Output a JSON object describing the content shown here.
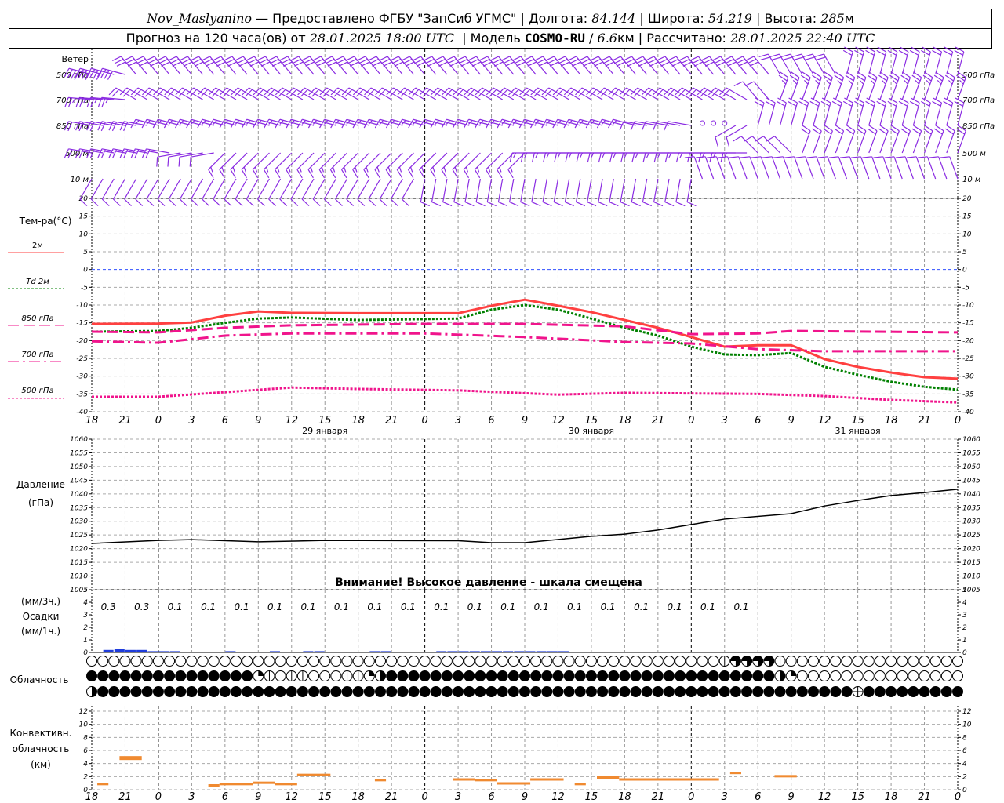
{
  "header": {
    "station": "Nov_Maslyanino",
    "provided": " — Предоставлено ФГБУ \"ЗапСиб УГМС\" | Долгота: ",
    "lon": "84.144",
    "lat_label": " | Широта: ",
    "lat": "54.219",
    "alt_label": " | Высота: ",
    "alt": "285",
    "alt_unit": "м",
    "forecast_label": "Прогноз на 120 часа(ов) от ",
    "forecast_time": "28.01.2025 18:00 UTC",
    "model_label": "  | Модель ",
    "model": "COSMO-RU",
    "model_sep": " / ",
    "res": "6.6",
    "res_unit": "км",
    "calc_label": " | Рассчитано: ",
    "calc_time": "28.01.2025 22:40 UTC"
  },
  "labels": {
    "wind": "Ветер",
    "wind_levels": [
      "500 гПа",
      "700 гПа",
      "850 гПа",
      "500 м",
      "10 м"
    ],
    "temp": "Тем-ра(°C)",
    "temp_legend": [
      "2м",
      "Td  2м",
      "850 гПа",
      "700 гПа",
      "500 гПа"
    ],
    "pressure": "Давление",
    "pressure_unit": "(гПа)",
    "precip_3h": "(мм/3ч.)",
    "precip": "Осадки",
    "precip_1h": "(мм/1ч.)",
    "cloud": "Облачность",
    "conv1": "Конвективн.",
    "conv2": "облачность",
    "conv3": "(км)",
    "warning": "Внимание! Высокое давление - шкала смещена"
  },
  "colors": {
    "t2m": "#ff4040",
    "td2m": "#008000",
    "upper": "#f0148c",
    "wind": "#8a2be2",
    "precip": "#1e3cdc",
    "conv": "#f08a30",
    "zero": "#3050ff"
  },
  "chart_data": {
    "type": "line",
    "x_unit": "hours since 28.01.2025 18:00 UTC",
    "time_labels": [
      "18",
      "21",
      "0",
      "3",
      "6",
      "9",
      "12",
      "15",
      "18",
      "21",
      "0",
      "3",
      "6",
      "9",
      "12",
      "15",
      "18",
      "21",
      "0",
      "3",
      "6",
      "9",
      "12",
      "15",
      "18",
      "21",
      "0"
    ],
    "date_labels": [
      {
        "h": 21,
        "text": "29 января"
      },
      {
        "h": 45,
        "text": "30 января"
      },
      {
        "h": 69,
        "text": "31 января"
      }
    ],
    "temperature": {
      "ylim": [
        -40,
        20
      ],
      "ticks": [
        20,
        15,
        10,
        5,
        0,
        -5,
        -10,
        -15,
        -20,
        -25,
        -30,
        -35,
        -40
      ],
      "series": [
        {
          "name": "2м",
          "style": "solid",
          "points": [
            [
              0,
              -15.3
            ],
            [
              6,
              -15.2
            ],
            [
              9,
              -14.9
            ],
            [
              12,
              -13
            ],
            [
              15,
              -11.8
            ],
            [
              18,
              -12.2
            ],
            [
              24,
              -12.3
            ],
            [
              33,
              -12.3
            ],
            [
              36,
              -10.2
            ],
            [
              39,
              -8.5
            ],
            [
              42,
              -10.2
            ],
            [
              45,
              -12
            ],
            [
              48,
              -14.2
            ],
            [
              51,
              -16.4
            ],
            [
              54,
              -19
            ],
            [
              57,
              -21.7
            ],
            [
              60,
              -21.3
            ],
            [
              63,
              -21.3
            ],
            [
              66,
              -25.2
            ],
            [
              69,
              -27.4
            ],
            [
              72,
              -29
            ],
            [
              75,
              -30.3
            ],
            [
              78,
              -30.7
            ]
          ]
        },
        {
          "name": "Td  2м",
          "style": "dotted-green",
          "points": [
            [
              0,
              -17.5
            ],
            [
              6,
              -17.3
            ],
            [
              9,
              -16.4
            ],
            [
              12,
              -15
            ],
            [
              15,
              -13.8
            ],
            [
              18,
              -13.5
            ],
            [
              24,
              -14.2
            ],
            [
              33,
              -13.8
            ],
            [
              36,
              -11.3
            ],
            [
              39,
              -10
            ],
            [
              42,
              -11.3
            ],
            [
              45,
              -13.8
            ],
            [
              48,
              -16.4
            ],
            [
              51,
              -18.6
            ],
            [
              54,
              -21.7
            ],
            [
              57,
              -23.9
            ],
            [
              60,
              -24.1
            ],
            [
              63,
              -23.5
            ],
            [
              66,
              -27.4
            ],
            [
              69,
              -29.6
            ],
            [
              72,
              -31.6
            ],
            [
              75,
              -33
            ],
            [
              78,
              -33.8
            ]
          ]
        },
        {
          "name": "850 гПа",
          "style": "dashed",
          "points": [
            [
              0,
              -17.5
            ],
            [
              6,
              -17.7
            ],
            [
              12,
              -16.4
            ],
            [
              18,
              -15.7
            ],
            [
              30,
              -15.3
            ],
            [
              39,
              -15.3
            ],
            [
              48,
              -16
            ],
            [
              54,
              -18.2
            ],
            [
              60,
              -18
            ],
            [
              63,
              -17.3
            ],
            [
              78,
              -17.7
            ]
          ]
        },
        {
          "name": "700 гПа",
          "style": "dashdot",
          "points": [
            [
              0,
              -20.2
            ],
            [
              6,
              -20.6
            ],
            [
              12,
              -18.6
            ],
            [
              18,
              -18
            ],
            [
              30,
              -18
            ],
            [
              39,
              -19
            ],
            [
              48,
              -20.4
            ],
            [
              54,
              -20.8
            ],
            [
              60,
              -22.4
            ],
            [
              66,
              -23
            ],
            [
              78,
              -23
            ]
          ]
        },
        {
          "name": "500 гПа",
          "style": "dotted",
          "points": [
            [
              0,
              -35.8
            ],
            [
              6,
              -35.8
            ],
            [
              12,
              -34.5
            ],
            [
              18,
              -33.2
            ],
            [
              24,
              -33.6
            ],
            [
              33,
              -34
            ],
            [
              42,
              -35.2
            ],
            [
              48,
              -34.7
            ],
            [
              60,
              -35
            ],
            [
              66,
              -35.6
            ],
            [
              72,
              -36.7
            ],
            [
              78,
              -37.4
            ]
          ]
        }
      ]
    },
    "pressure": {
      "ylim": [
        1005,
        1060
      ],
      "ticks": [
        1060,
        1055,
        1050,
        1045,
        1040,
        1035,
        1030,
        1025,
        1020,
        1015,
        1010,
        1005
      ],
      "points": [
        [
          0,
          1021.9
        ],
        [
          6,
          1023
        ],
        [
          9,
          1023.3
        ],
        [
          15,
          1022.5
        ],
        [
          21,
          1023
        ],
        [
          33,
          1022.9
        ],
        [
          36,
          1022.2
        ],
        [
          39,
          1022.2
        ],
        [
          45,
          1024.5
        ],
        [
          48,
          1025.3
        ],
        [
          51,
          1026.8
        ],
        [
          54,
          1028.8
        ],
        [
          57,
          1030.8
        ],
        [
          63,
          1032.8
        ],
        [
          66,
          1035.6
        ],
        [
          69,
          1037.6
        ],
        [
          72,
          1039.4
        ],
        [
          75,
          1040.5
        ],
        [
          78,
          1041.7
        ]
      ]
    },
    "precip": {
      "ylim": [
        0,
        5
      ],
      "ticks": [
        5,
        4,
        3,
        2,
        1,
        0
      ],
      "totals_3h": [
        "0.3",
        "0.3",
        "0.1",
        "0.1",
        "0.1",
        "0.1",
        "0.1",
        "0.1",
        "0.1",
        "0.1",
        "0.1",
        "0.1",
        "0.1",
        "0.1",
        "0.1",
        "0.1",
        "0.1",
        "0.1",
        "0.1",
        "0.1"
      ],
      "hourly": [
        0,
        0.2,
        0.3,
        0.2,
        0.2,
        0.1,
        0.1,
        0.1,
        0.05,
        0.05,
        0.05,
        0.05,
        0.1,
        0.05,
        0.05,
        0.05,
        0.1,
        0.05,
        0.05,
        0.1,
        0.1,
        0.05,
        0.05,
        0.05,
        0.05,
        0.1,
        0.1,
        0.05,
        0.05,
        0.05,
        0.05,
        0.1,
        0.1,
        0.1,
        0.1,
        0.1,
        0.1,
        0.1,
        0.1,
        0.1,
        0.1,
        0.1,
        0.1,
        0,
        0,
        0,
        0,
        0,
        0,
        0,
        0,
        0,
        0,
        0,
        0,
        0,
        0,
        0,
        0,
        0,
        0,
        0,
        0.05,
        0,
        0,
        0,
        0,
        0,
        0,
        0.05,
        0,
        0,
        0,
        0,
        0,
        0,
        0,
        0
      ]
    },
    "cloud_rows": [
      "0000000000000000000000000000000000000000000000000000000001666610000000000000000",
      "8888888888888882101100011248888888888888888888888888888888888842000000000000000",
      "4888888888888888888888888888888888888888888888888888888888888888888885888888888"
    ],
    "convective": {
      "ylim": [
        0,
        13
      ],
      "ticks": [
        12,
        10,
        8,
        6,
        4,
        2,
        0
      ],
      "bars": [
        [
          0.5,
          1.5,
          0.8
        ],
        [
          2.5,
          4.5,
          4.9
        ],
        [
          10.5,
          11.5,
          0.6
        ],
        [
          11.5,
          14.5,
          0.8
        ],
        [
          14.5,
          16.5,
          1.0
        ],
        [
          16.5,
          18.5,
          0.8
        ],
        [
          18.5,
          21.5,
          2.2
        ],
        [
          25.5,
          26.5,
          1.4
        ],
        [
          32.5,
          34.5,
          1.5
        ],
        [
          34.5,
          36.5,
          1.4
        ],
        [
          36.5,
          39.5,
          0.9
        ],
        [
          39.5,
          42.5,
          1.5
        ],
        [
          43.5,
          44.5,
          0.8
        ],
        [
          45.5,
          47.5,
          1.8
        ],
        [
          47.5,
          56.5,
          1.5
        ],
        [
          57.5,
          58.5,
          2.5
        ],
        [
          61.5,
          63.5,
          2.0
        ]
      ]
    },
    "wind": [
      {
        "level": "500 гПа",
        "segments": [
          [
            0,
            4,
            285,
            20
          ],
          [
            4,
            62,
            320,
            15
          ],
          [
            62,
            68,
            330,
            10
          ],
          [
            68,
            79,
            15,
            10
          ]
        ]
      },
      {
        "level": "700 гПа",
        "segments": [
          [
            0,
            4,
            275,
            12
          ],
          [
            4,
            60,
            300,
            10
          ],
          [
            60,
            62,
            320,
            5
          ],
          [
            62,
            79,
            20,
            12
          ]
        ]
      },
      {
        "level": "850 гПа",
        "segments": [
          [
            0,
            6,
            280,
            10
          ],
          [
            6,
            50,
            285,
            8
          ],
          [
            50,
            55,
            280,
            5
          ],
          [
            55,
            58,
            0,
            0
          ],
          [
            58,
            60,
            240,
            5
          ],
          [
            60,
            79,
            15,
            10
          ]
        ]
      },
      {
        "level": "500 м",
        "segments": [
          [
            0,
            8,
            280,
            10
          ],
          [
            8,
            12,
            260,
            5
          ],
          [
            12,
            40,
            225,
            8
          ],
          [
            40,
            60,
            270,
            7
          ],
          [
            60,
            64,
            315,
            5
          ],
          [
            64,
            79,
            20,
            10
          ]
        ]
      },
      {
        "level": "10 м",
        "segments": [
          [
            0,
            30,
            210,
            5
          ],
          [
            30,
            55,
            190,
            4
          ],
          [
            55,
            79,
            340,
            5
          ]
        ]
      }
    ]
  }
}
